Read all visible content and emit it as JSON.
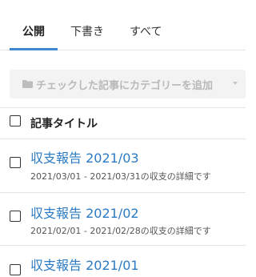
{
  "tabs": [
    {
      "label": "公開",
      "active": true
    },
    {
      "label": "下書き",
      "active": false
    },
    {
      "label": "すべて",
      "active": false
    }
  ],
  "category_bar": {
    "icon": "folder-icon",
    "label": "チェックした記事にカテゴリーを追加",
    "caret": "chevron-down-icon"
  },
  "list_header": {
    "title": "記事タイトル"
  },
  "entries": [
    {
      "title": "収支報告 2021/03",
      "description": "2021/03/01 - 2021/03/31の収支の詳細です"
    },
    {
      "title": "収支報告 2021/02",
      "description": "2021/02/01 - 2021/02/28の収支の詳細です"
    },
    {
      "title": "収支報告 2021/01",
      "description": ""
    }
  ],
  "colors": {
    "accent": "#3f86d0",
    "link": "#2b7bc4",
    "disabled_bg": "#f3f3f3",
    "disabled_text": "#b9b9b9"
  }
}
